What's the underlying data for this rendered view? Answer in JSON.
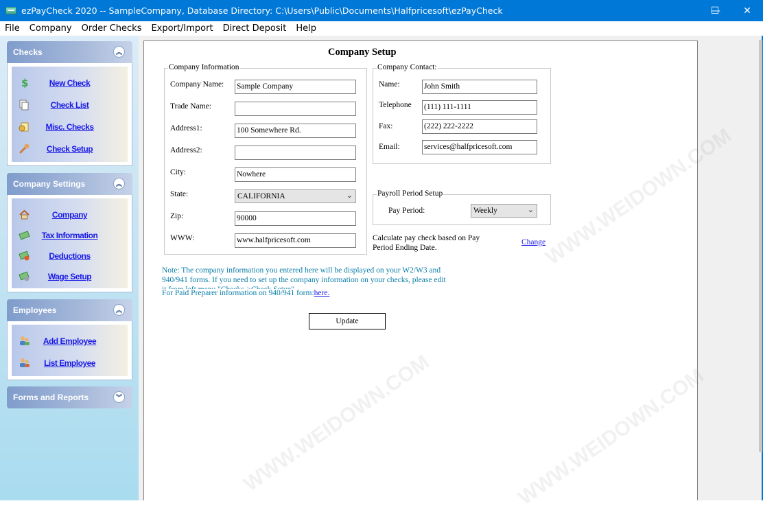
{
  "window": {
    "title": "ezPayCheck 2020 -- SampleCompany, Database Directory: C:\\Users\\Public\\Documents\\Halfpricesoft\\ezPayCheck",
    "minimize": "—",
    "maximize": "☐",
    "close": "✕"
  },
  "menu": [
    "File",
    "Company",
    "Order Checks",
    "Export/Import",
    "Direct Deposit",
    "Help"
  ],
  "sidebar": {
    "checks": {
      "title": "Checks",
      "items": [
        "New Check",
        "Check List",
        "Misc. Checks",
        "Check Setup"
      ]
    },
    "company_settings": {
      "title": "Company Settings",
      "items": [
        "Company",
        "Tax Information",
        "Deductions",
        "Wage Setup"
      ]
    },
    "employees": {
      "title": "Employees",
      "items": [
        "Add Employee",
        "List Employee"
      ]
    },
    "forms_reports": {
      "title": "Forms and Reports"
    }
  },
  "form": {
    "title": "Company Setup",
    "company_info": {
      "legend": "Company Information",
      "company_name_label": "Company Name:",
      "company_name": "Sample Company",
      "trade_name_label": "Trade Name:",
      "trade_name": "",
      "address1_label": "Address1:",
      "address1": "100 Somewhere Rd.",
      "address2_label": "Address2:",
      "address2": "",
      "city_label": "City:",
      "city": "Nowhere",
      "state_label": "State:",
      "state": "CALIFORNIA",
      "zip_label": "Zip:",
      "zip": "90000",
      "www_label": "WWW:",
      "www": "www.halfpricesoft.com"
    },
    "company_contact": {
      "legend": "Company Contact:",
      "name_label": "Name:",
      "name": "John Smith",
      "telephone_label": "Telephone",
      "telephone": "(111) 111-1111",
      "fax_label": "Fax:",
      "fax": "(222) 222-2222",
      "email_label": "Email:",
      "email": "services@halfpricesoft.com"
    },
    "payroll": {
      "legend": "Payroll Period Setup",
      "pay_period_label": "Pay Period:",
      "pay_period": "Weekly",
      "calc_text_1": "Calculate pay check based on Pay",
      "calc_text_2": "Period Ending Date.",
      "change_link": "Change"
    },
    "note_1": "Note: The company information you entered here will be displayed on your W2/W3 and",
    "note_2": "940/941 forms.  If you need to set up the company information on your checks, please edit",
    "note_3": "it from left menu \"Checks->Check Setup\".",
    "note_4": "For Paid Preparer information on 940/941 form:",
    "note_link": "here.",
    "update_button": "Update"
  },
  "watermark": "WWW.WEIDOWN.COM"
}
